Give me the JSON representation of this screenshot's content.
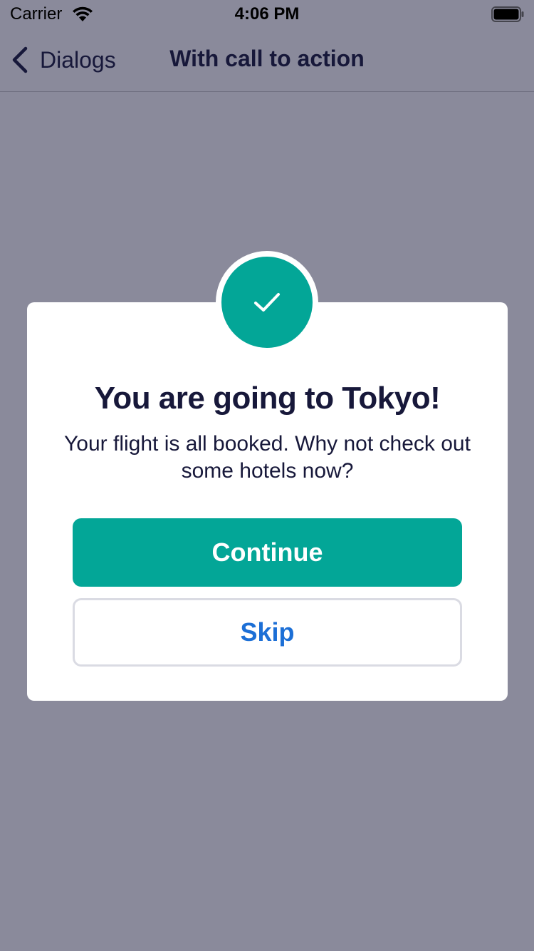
{
  "status_bar": {
    "carrier": "Carrier",
    "time": "4:06 PM"
  },
  "nav": {
    "back_label": "Dialogs",
    "title": "With call to action"
  },
  "dialog": {
    "icon": "checkmark-icon",
    "title": "You are going to Tokyo!",
    "message": "Your flight is all booked. Why not check out some hotels now?",
    "primary_label": "Continue",
    "secondary_label": "Skip"
  },
  "colors": {
    "accent": "#03a697",
    "link": "#1c6fd6",
    "text": "#17183a",
    "overlay": "#8a8a9b"
  }
}
